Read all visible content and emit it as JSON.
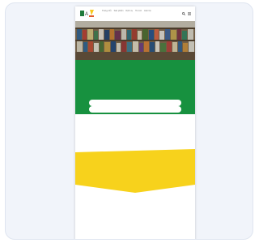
{
  "header": {
    "nav_items": [
      "Trang chủ",
      "Sản phẩm",
      "Dịch vụ",
      "Tin tức",
      "Liên hệ"
    ]
  },
  "hero": {
    "title": "",
    "subtitle": ""
  },
  "promo": {
    "lines": [
      "",
      "",
      ""
    ],
    "price": "",
    "primary_button": "",
    "secondary_button": ""
  },
  "colors": {
    "brand_green": "#17913f",
    "accent_yellow": "#f7d21c",
    "card_background": "#f1f4fa"
  },
  "icons": [
    "logo-icon",
    "search-icon",
    "menu-icon"
  ]
}
